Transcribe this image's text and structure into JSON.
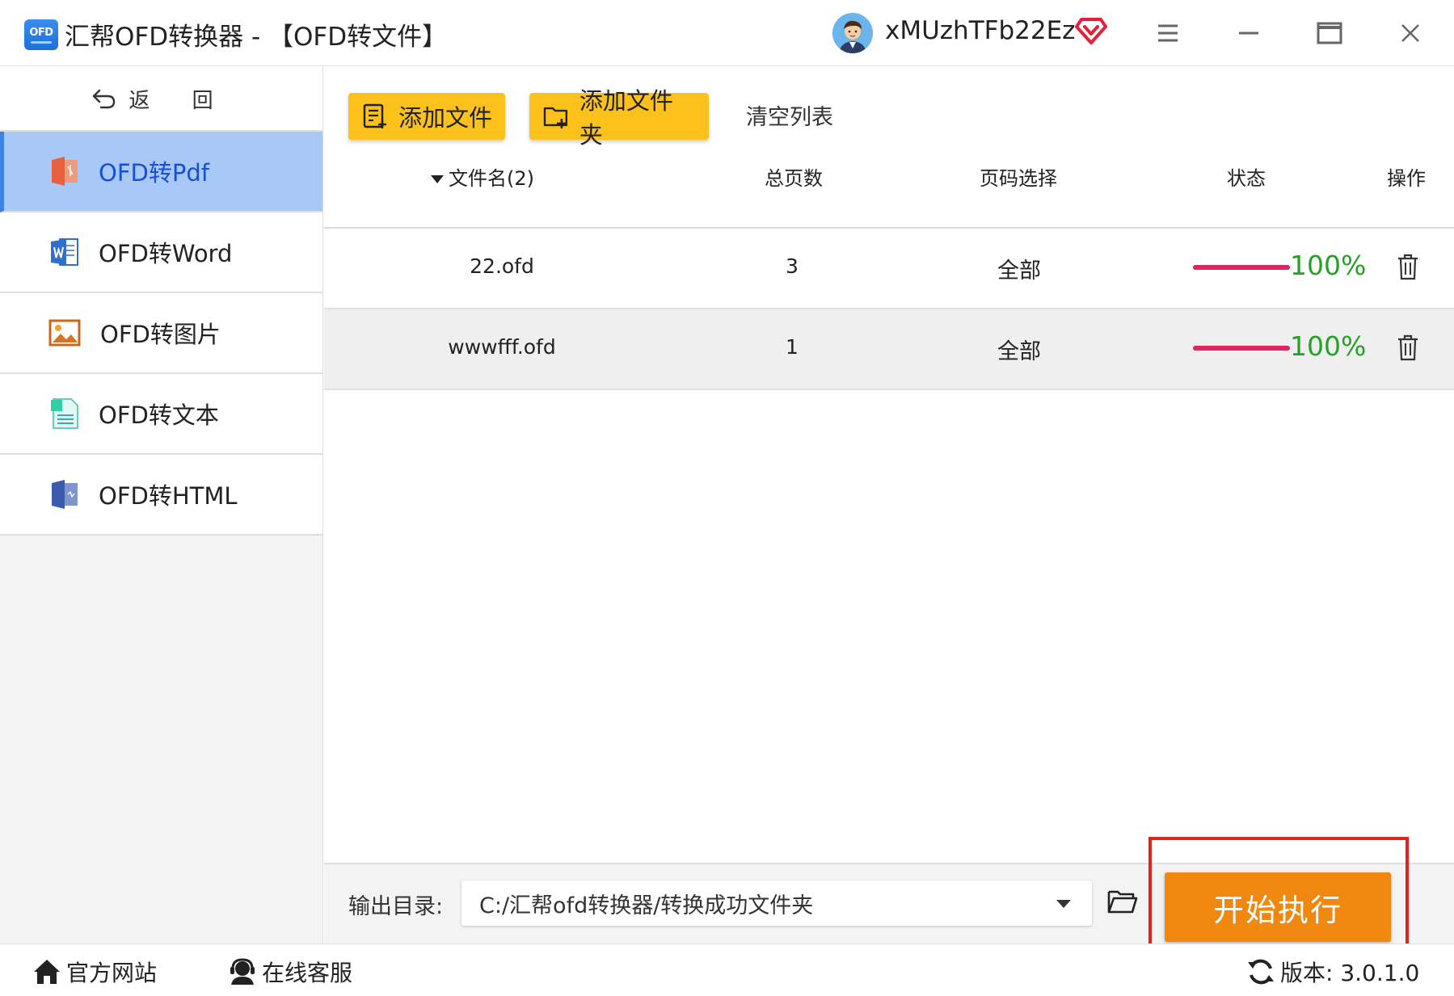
{
  "titlebar": {
    "app_logo_text": "OFD",
    "title": "汇帮OFD转换器 - 【OFD转文件】",
    "username": "xMUzhTFb22Ez",
    "icons": [
      "menu-icon",
      "minimize-icon",
      "maximize-icon",
      "close-icon"
    ]
  },
  "sidebar": {
    "back_label": "返 回",
    "items": [
      {
        "label": "OFD转Pdf",
        "icon": "pdf-file-icon",
        "active": true
      },
      {
        "label": "OFD转Word",
        "icon": "word-file-icon",
        "active": false
      },
      {
        "label": "OFD转图片",
        "icon": "image-file-icon",
        "active": false
      },
      {
        "label": "OFD转文本",
        "icon": "text-file-icon",
        "active": false
      },
      {
        "label": "OFD转HTML",
        "icon": "html-file-icon",
        "active": false
      }
    ]
  },
  "toolbar": {
    "add_file": "添加文件",
    "add_folder": "添加文件夹",
    "clear_list": "清空列表"
  },
  "table": {
    "headers": {
      "filename": "文件名(2)",
      "pages": "总页数",
      "page_select": "页码选择",
      "status": "状态",
      "actions": "操作"
    },
    "rows": [
      {
        "filename": "22.ofd",
        "pages": "3",
        "page_select": "全部",
        "progress": 1.0,
        "status": "100%"
      },
      {
        "filename": "wwwfff.ofd",
        "pages": "1",
        "page_select": "全部",
        "progress": 1.0,
        "status": "100%"
      }
    ]
  },
  "output": {
    "label": "输出目录:",
    "path": "C:/汇帮ofd转换器/转换成功文件夹",
    "start_label": "开始执行"
  },
  "footer": {
    "official_site": "官方网站",
    "online_service": "在线客服",
    "version": "版本: 3.0.1.0"
  },
  "colors": {
    "accent_yellow": "#fcc21b",
    "start_orange": "#f0870f",
    "active_item_bg": "#a8c8f8",
    "active_item_text": "#1750d6",
    "progress_bar": "#e0245e",
    "status_green": "#27a027",
    "highlight_red": "#e62020"
  }
}
